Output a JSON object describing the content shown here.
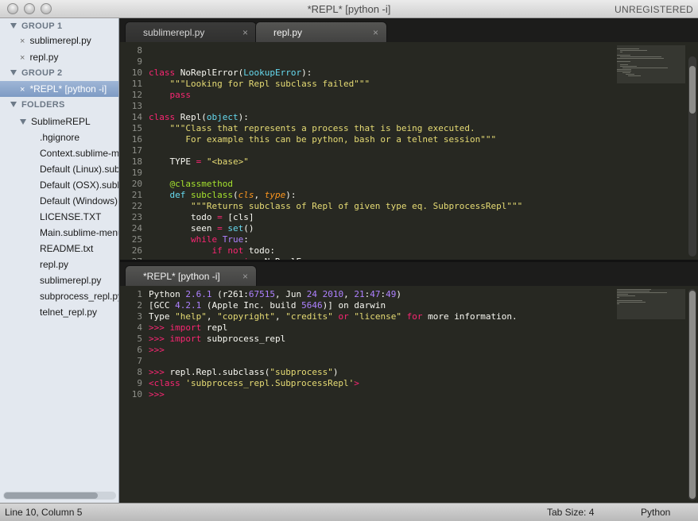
{
  "window": {
    "title": "*REPL* [python -i]",
    "license_label": "UNREGISTERED"
  },
  "sidebar": {
    "group1_label": "GROUP 1",
    "group1_files": [
      "sublimerepl.py",
      "repl.py"
    ],
    "group2_label": "GROUP 2",
    "group2_files": [
      "*REPL* [python -i]"
    ],
    "folders_label": "FOLDERS",
    "folder_name": "SublimeREPL",
    "folder_files": [
      ".hgignore",
      "Context.sublime-menu",
      "Default (Linux).sublime-keymap",
      "Default (OSX).sublime-keymap",
      "Default (Windows).sublime-keymap",
      "LICENSE.TXT",
      "Main.sublime-menu",
      "README.txt",
      "repl.py",
      "sublimerepl.py",
      "subprocess_repl.py",
      "telnet_repl.py"
    ]
  },
  "top_tabs": [
    {
      "label": "sublimerepl.py",
      "active": false
    },
    {
      "label": "repl.py",
      "active": true
    }
  ],
  "bottom_tabs": [
    {
      "label": "*REPL* [python -i]",
      "active": true
    }
  ],
  "tab_close_glyph": "×",
  "editor_top": {
    "line_numbers": [
      "8",
      "9",
      "10",
      "11",
      "12",
      "13",
      "14",
      "15",
      "16",
      "17",
      "18",
      "19",
      "20",
      "21",
      "22",
      "23",
      "24",
      "25",
      "26",
      "27"
    ],
    "lines": [
      [],
      [],
      [
        [
          "kw",
          "class "
        ],
        [
          "nm",
          "NoReplError"
        ],
        [
          "nm",
          "("
        ],
        [
          "bi",
          "LookupError"
        ],
        [
          "nm",
          "):"
        ]
      ],
      [
        [
          "nm",
          "    "
        ],
        [
          "st",
          "\"\"\"Looking for Repl subclass failed\"\"\""
        ]
      ],
      [
        [
          "nm",
          "    "
        ],
        [
          "kw",
          "pass"
        ]
      ],
      [],
      [
        [
          "kw",
          "class "
        ],
        [
          "nm",
          "Repl"
        ],
        [
          "nm",
          "("
        ],
        [
          "bi",
          "object"
        ],
        [
          "nm",
          "):"
        ]
      ],
      [
        [
          "nm",
          "    "
        ],
        [
          "st",
          "\"\"\"Class that represents a process that is being executed."
        ]
      ],
      [
        [
          "st",
          "       For example this can be python, bash or a telnet session\"\"\""
        ]
      ],
      [],
      [
        [
          "nm",
          "    TYPE "
        ],
        [
          "kw",
          "="
        ],
        [
          "nm",
          " "
        ],
        [
          "st",
          "\"<base>\""
        ]
      ],
      [],
      [
        [
          "nm",
          "    "
        ],
        [
          "de",
          "@classmethod"
        ]
      ],
      [
        [
          "nm",
          "    "
        ],
        [
          "bi",
          "def "
        ],
        [
          "fn",
          "subclass"
        ],
        [
          "nm",
          "("
        ],
        [
          "pa",
          "cls"
        ],
        [
          "nm",
          ", "
        ],
        [
          "pa",
          "type"
        ],
        [
          "nm",
          "):"
        ]
      ],
      [
        [
          "nm",
          "        "
        ],
        [
          "st",
          "\"\"\"Returns subclass of Repl of given type eq. SubprocessRepl\"\"\""
        ]
      ],
      [
        [
          "nm",
          "        todo "
        ],
        [
          "kw",
          "="
        ],
        [
          "nm",
          " [cls]"
        ]
      ],
      [
        [
          "nm",
          "        seen "
        ],
        [
          "kw",
          "="
        ],
        [
          "nm",
          " "
        ],
        [
          "bi",
          "set"
        ],
        [
          "nm",
          "()"
        ]
      ],
      [
        [
          "nm",
          "        "
        ],
        [
          "kw",
          "while "
        ],
        [
          "nu",
          "True"
        ],
        [
          "nm",
          ":"
        ]
      ],
      [
        [
          "nm",
          "            "
        ],
        [
          "kw",
          "if not "
        ],
        [
          "nm",
          "todo:"
        ]
      ],
      [
        [
          "nm",
          "                "
        ],
        [
          "kw",
          "raise "
        ],
        [
          "nm",
          "NoReplError"
        ]
      ]
    ]
  },
  "editor_bottom": {
    "line_numbers": [
      "1",
      "2",
      "3",
      "4",
      "5",
      "6",
      "7",
      "8",
      "9",
      "10"
    ],
    "lines": [
      [
        [
          "nm",
          "Python "
        ],
        [
          "nu",
          "2.6.1"
        ],
        [
          "nm",
          " (r261:"
        ],
        [
          "nu",
          "67515"
        ],
        [
          "nm",
          ", Jun "
        ],
        [
          "nu",
          "24"
        ],
        [
          "nm",
          " "
        ],
        [
          "nu",
          "2010"
        ],
        [
          "nm",
          ", "
        ],
        [
          "nu",
          "21"
        ],
        [
          "nm",
          ":"
        ],
        [
          "nu",
          "47"
        ],
        [
          "nm",
          ":"
        ],
        [
          "nu",
          "49"
        ],
        [
          "nm",
          ")"
        ]
      ],
      [
        [
          "nm",
          "[GCC "
        ],
        [
          "nu",
          "4.2.1"
        ],
        [
          "nm",
          " (Apple Inc. build "
        ],
        [
          "nu",
          "5646"
        ],
        [
          "nm",
          ")] on darwin"
        ]
      ],
      [
        [
          "nm",
          "Type "
        ],
        [
          "st",
          "\"help\""
        ],
        [
          "nm",
          ", "
        ],
        [
          "st",
          "\"copyright\""
        ],
        [
          "nm",
          ", "
        ],
        [
          "st",
          "\"credits\""
        ],
        [
          "nm",
          " "
        ],
        [
          "kw",
          "or"
        ],
        [
          "nm",
          " "
        ],
        [
          "st",
          "\"license\""
        ],
        [
          "nm",
          " "
        ],
        [
          "kw",
          "for"
        ],
        [
          "nm",
          " more information."
        ]
      ],
      [
        [
          "pr",
          ">>> "
        ],
        [
          "kw",
          "import "
        ],
        [
          "nm",
          "repl"
        ]
      ],
      [
        [
          "pr",
          ">>> "
        ],
        [
          "kw",
          "import "
        ],
        [
          "nm",
          "subprocess_repl"
        ]
      ],
      [
        [
          "pr",
          ">>>"
        ]
      ],
      [],
      [
        [
          "pr",
          ">>> "
        ],
        [
          "nm",
          "repl.Repl.subclass("
        ],
        [
          "st",
          "\"subprocess\""
        ],
        [
          "nm",
          ")"
        ]
      ],
      [
        [
          "kw",
          "<class "
        ],
        [
          "st",
          "'subprocess_repl.SubprocessRepl'"
        ],
        [
          "kw",
          ">"
        ]
      ],
      [
        [
          "pr",
          ">>>"
        ]
      ]
    ]
  },
  "status": {
    "position": "Line 10, Column 5",
    "tab_size": "Tab Size: 4",
    "syntax": "Python"
  },
  "icons": {
    "close": "×",
    "disclosure": "triangle-down-icon"
  },
  "colors": {
    "editor_bg": "#272822",
    "keyword": "#f92672",
    "string": "#e6db74",
    "number": "#ae81ff",
    "builtin": "#66d9ef",
    "decorator": "#a6e22e",
    "sidebar_bg": "#e3e8ef",
    "selection": "#7e9bc4"
  }
}
